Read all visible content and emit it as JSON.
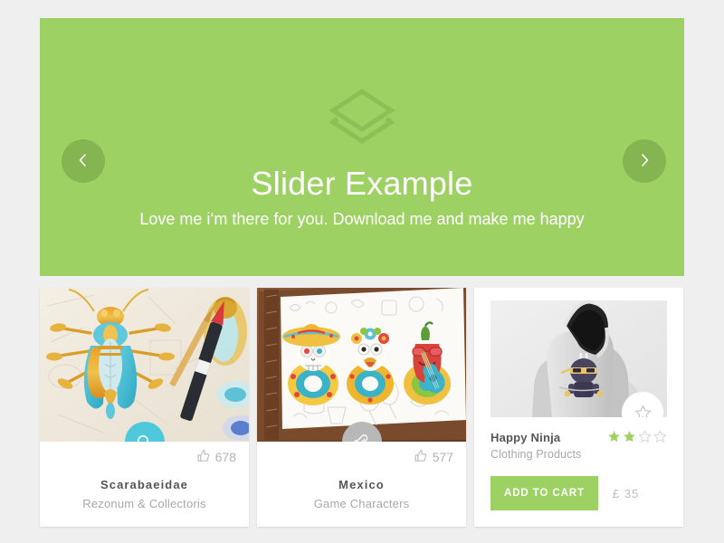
{
  "slider": {
    "title": "Slider Example",
    "subtitle": "Love me i‘m there for you. Download me and make me happy",
    "logo_icon": "layers-icon",
    "background_color": "#9ed163",
    "prev_icon": "chevron-left-icon",
    "next_icon": "chevron-right-icon",
    "arrow_color": "#84b551"
  },
  "cards": [
    {
      "title": "Scarabaeidae",
      "subtitle": "Rezonum & Collectoris",
      "likes": "678",
      "like_icon": "thumbs-up-icon",
      "action_icon": "search-icon",
      "action_color": "#4fc8dc",
      "image_alt": "beetle illustration on sketchbook with brushes"
    },
    {
      "title": "Mexico",
      "subtitle": "Game Characters",
      "likes": "577",
      "like_icon": "thumbs-up-icon",
      "action_icon": "paperclip-icon",
      "action_color": "#b8b8b8",
      "image_alt": "three mexican character illustrations in sketchbook"
    }
  ],
  "product": {
    "title": "Happy Ninja",
    "subtitle": "Clothing Products",
    "rating": 2,
    "rating_max": 4,
    "star_filled_color": "#9ed163",
    "star_empty_color": "#d8d8d8",
    "favorite_icon": "star-outline-icon",
    "add_to_cart_label": "ADD TO CART",
    "add_to_cart_color": "#9ed163",
    "price": "£ 35",
    "image_alt": "grey hoodie with ninja print"
  },
  "page": {
    "background_color": "#efefef"
  }
}
